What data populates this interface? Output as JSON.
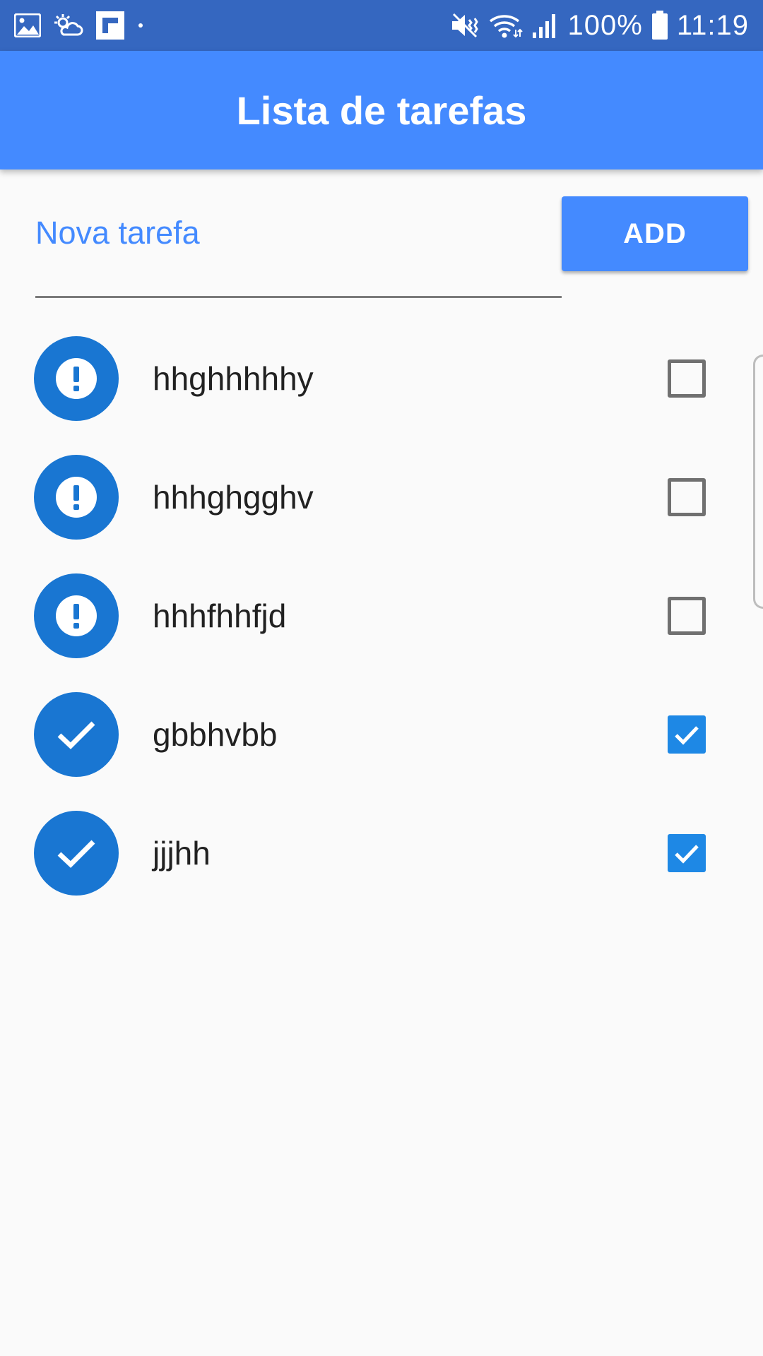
{
  "status_bar": {
    "battery": "100%",
    "time": "11:19",
    "icons": [
      "image-icon",
      "weather-icon",
      "flipboard-icon",
      "dot-icon",
      "vibrate-icon",
      "wifi-icon",
      "signal-icon",
      "battery-icon"
    ]
  },
  "app_bar": {
    "title": "Lista de tarefas"
  },
  "new_task": {
    "placeholder": "Nova tarefa",
    "value": "",
    "add_label": "ADD"
  },
  "tasks": [
    {
      "label": "hhghhhhhy",
      "done": false,
      "icon": "exclamation-icon"
    },
    {
      "label": "hhhghgghv",
      "done": false,
      "icon": "exclamation-icon"
    },
    {
      "label": "hhhfhhfjd",
      "done": false,
      "icon": "exclamation-icon"
    },
    {
      "label": "gbbhvbb",
      "done": true,
      "icon": "check-icon"
    },
    {
      "label": "jjjhh",
      "done": true,
      "icon": "check-icon"
    }
  ],
  "colors": {
    "status_bar": "#3567c0",
    "app_bar": "#448aff",
    "avatar": "#1976d2",
    "checkbox_on": "#1e88e5"
  }
}
